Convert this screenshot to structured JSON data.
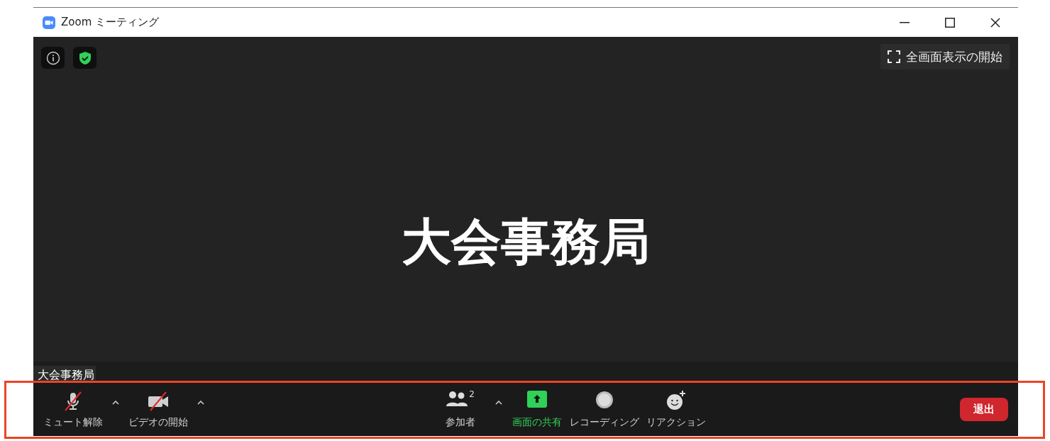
{
  "window": {
    "title": "Zoom ミーティング"
  },
  "fullscreen_button": {
    "label": "全画面表示の開始"
  },
  "video_area": {
    "display_name": "大会事務局",
    "name_tag": "大会事務局"
  },
  "toolbar": {
    "left": [
      {
        "kind": "mic",
        "label": "ミュート解除",
        "off": true,
        "menu": true
      },
      {
        "kind": "video",
        "label": "ビデオの開始",
        "off": true,
        "menu": true
      }
    ],
    "center": [
      {
        "kind": "participants",
        "label": "参加者",
        "count": "2",
        "menu": true,
        "highlighted": false
      },
      {
        "kind": "share",
        "label": "画面の共有",
        "menu": false,
        "highlighted": true
      },
      {
        "kind": "record",
        "label": "レコーディング",
        "menu": false,
        "highlighted": false
      },
      {
        "kind": "reaction",
        "label": "リアクション",
        "menu": false,
        "highlighted": false
      }
    ],
    "leave_button": {
      "label": "退出"
    }
  }
}
